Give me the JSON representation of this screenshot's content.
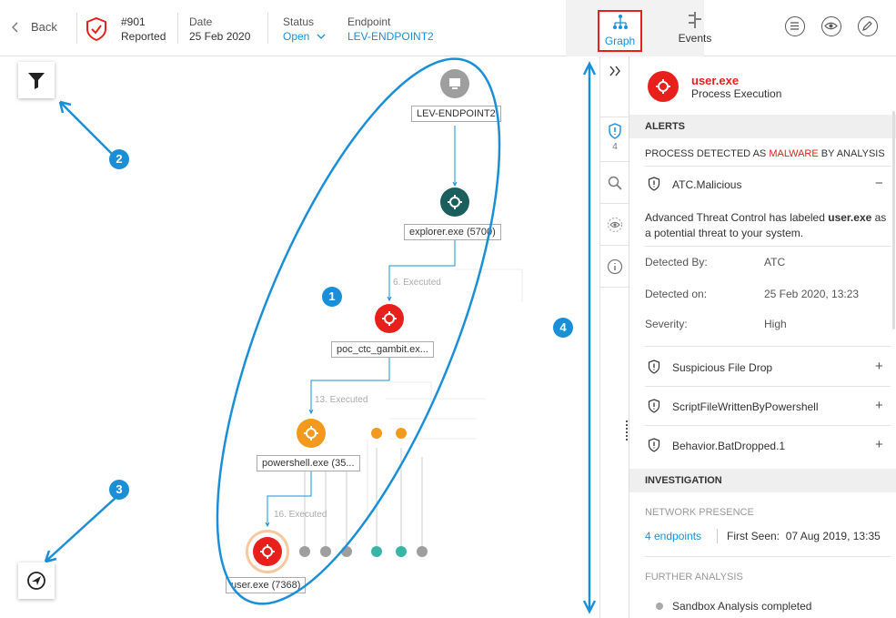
{
  "topbar": {
    "back_label": "Back",
    "incident_id": "#901",
    "incident_state": "Reported",
    "date_label": "Date",
    "date_value": "25 Feb 2020",
    "status_label": "Status",
    "status_value": "Open",
    "endpoint_label": "Endpoint",
    "endpoint_value": "LEV-ENDPOINT2",
    "tab_graph": "Graph",
    "tab_events": "Events",
    "active_tab": "Graph"
  },
  "graph": {
    "nodes": [
      {
        "label": "LEV-ENDPOINT2",
        "icon": "computer-icon",
        "color": "#9e9e9e"
      },
      {
        "label": "explorer.exe (5700)",
        "icon": "process-icon",
        "color": "#1b5e5e"
      },
      {
        "label": "poc_ctc_gambit.ex...",
        "icon": "process-icon",
        "color": "#e8201c"
      },
      {
        "label": "powershell.exe (35...",
        "icon": "process-icon",
        "color": "#f39a1e"
      },
      {
        "label": "user.exe (7368)",
        "icon": "process-icon",
        "color": "#e8201c"
      }
    ],
    "edges": [
      "6. Executed",
      "13. Executed",
      "16. Executed"
    ],
    "callouts": [
      "1",
      "2",
      "3",
      "4"
    ]
  },
  "strip": {
    "expand_icon": "double-chevron-right-icon",
    "alert_count": "4"
  },
  "panel": {
    "process_name": "user.exe",
    "process_type": "Process Execution",
    "alerts_heading": "ALERTS",
    "detected_prefix": "PROCESS DETECTED AS ",
    "detected_highlight": "MALWARE",
    "detected_suffix": " BY ANALYSIS",
    "alerts": [
      {
        "name": "ATC.Malicious",
        "toggle": "−"
      },
      {
        "name": "Suspicious File Drop",
        "toggle": "+"
      },
      {
        "name": "ScriptFileWrittenByPowershell",
        "toggle": "+"
      },
      {
        "name": "Behavior.BatDropped.1",
        "toggle": "+"
      }
    ],
    "desc_prefix": "Advanced Threat Control has labeled ",
    "desc_bold": "user.exe",
    "desc_suffix": " as a potential threat to your system.",
    "detected_by_label": "Detected By:",
    "detected_by_value": "ATC",
    "detected_on_label": "Detected on:",
    "detected_on_value": "25 Feb 2020, 13:23",
    "severity_label": "Severity:",
    "severity_value": "High",
    "investigation_heading": "INVESTIGATION",
    "network_heading": "NETWORK PRESENCE",
    "endpoints_link": "4 endpoints",
    "first_seen": "First Seen:  07 Aug 2019, 13:35",
    "further_heading": "FURTHER ANALYSIS",
    "sandbox": "Sandbox Analysis completed"
  },
  "colors": {
    "accent": "#1a8fd8",
    "danger": "#e8201c",
    "warning": "#f39a1e",
    "teal": "#1b5e5e"
  }
}
